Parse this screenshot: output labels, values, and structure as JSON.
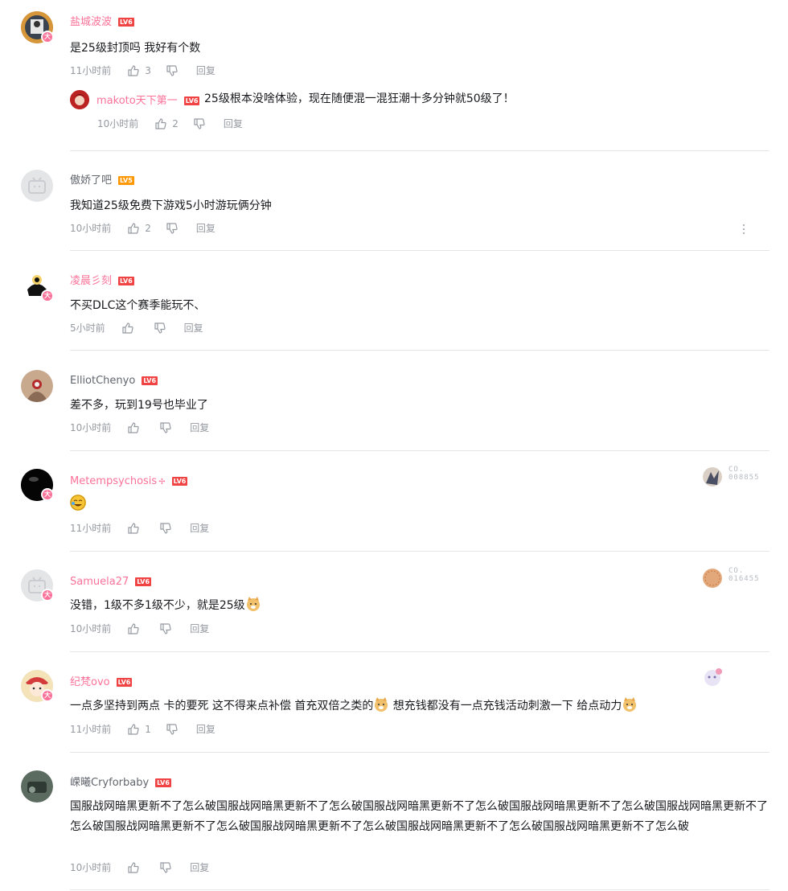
{
  "comments": [
    {
      "username": "盐城波波",
      "level": "LV6",
      "text": "是25级封顶吗 我好有个数",
      "time": "11小时前",
      "likes": "3",
      "reply_label": "回复",
      "sub_reply": {
        "username": "makoto天下第一",
        "level": "LV6",
        "text": "25级根本没啥体验，现在随便混一混狂潮十多分钟就50级了！",
        "time": "10小时前",
        "likes": "2",
        "reply_label": "回复"
      }
    },
    {
      "username": "傲娇了吧",
      "level": "LV5",
      "text": "我知道25级免费下游戏5小时游玩俩分钟",
      "time": "10小时前",
      "likes": "2",
      "reply_label": "回复"
    },
    {
      "username": "凌晨彡刻",
      "level": "LV6",
      "text": "不买DLC这个赛季能玩不、",
      "time": "5小时前",
      "likes": "",
      "reply_label": "回复"
    },
    {
      "username": "ElliotChenyo",
      "level": "LV6",
      "text": "差不多，玩到19号也毕业了",
      "time": "10小时前",
      "likes": "",
      "reply_label": "回复"
    },
    {
      "username": "Metempsychosis",
      "level": "LV6",
      "text": "",
      "time": "11小时前",
      "likes": "",
      "reply_label": "回复",
      "fan_badge_co": "CO.",
      "fan_badge_no": "008855"
    },
    {
      "username": "Samuela27",
      "level": "LV6",
      "text": "没错，1级不多1级不少，就是25级",
      "time": "10小时前",
      "likes": "",
      "reply_label": "回复",
      "fan_badge_co": "CO.",
      "fan_badge_no": "016455"
    },
    {
      "username": "纪梵ovo",
      "level": "LV6",
      "text_a": "一点多坚持到两点 卡的要死 这不得来点补偿 首充双倍之类的",
      "text_b": " 想充钱都没有一点充钱活动刺激一下 给点动力",
      "time": "11小时前",
      "likes": "1",
      "reply_label": "回复"
    },
    {
      "username": "嵘曦Cryforbaby",
      "level": "LV6",
      "text": "国服战网暗黑更新不了怎么破国服战网暗黑更新不了怎么破国服战网暗黑更新不了怎么破国服战网暗黑更新不了怎么破国服战网暗黑更新不了怎么破国服战网暗黑更新不了怎么破国服战网暗黑更新不了怎么破国服战网暗黑更新不了怎么破国服战网暗黑更新不了怎么破",
      "time": "10小时前",
      "likes": "",
      "reply_label": "回复"
    }
  ],
  "vip_badge_glyph": "大",
  "colors": {
    "vip_name": "#fb7299",
    "level_badge": "#f04444",
    "meta": "#9499a0"
  }
}
